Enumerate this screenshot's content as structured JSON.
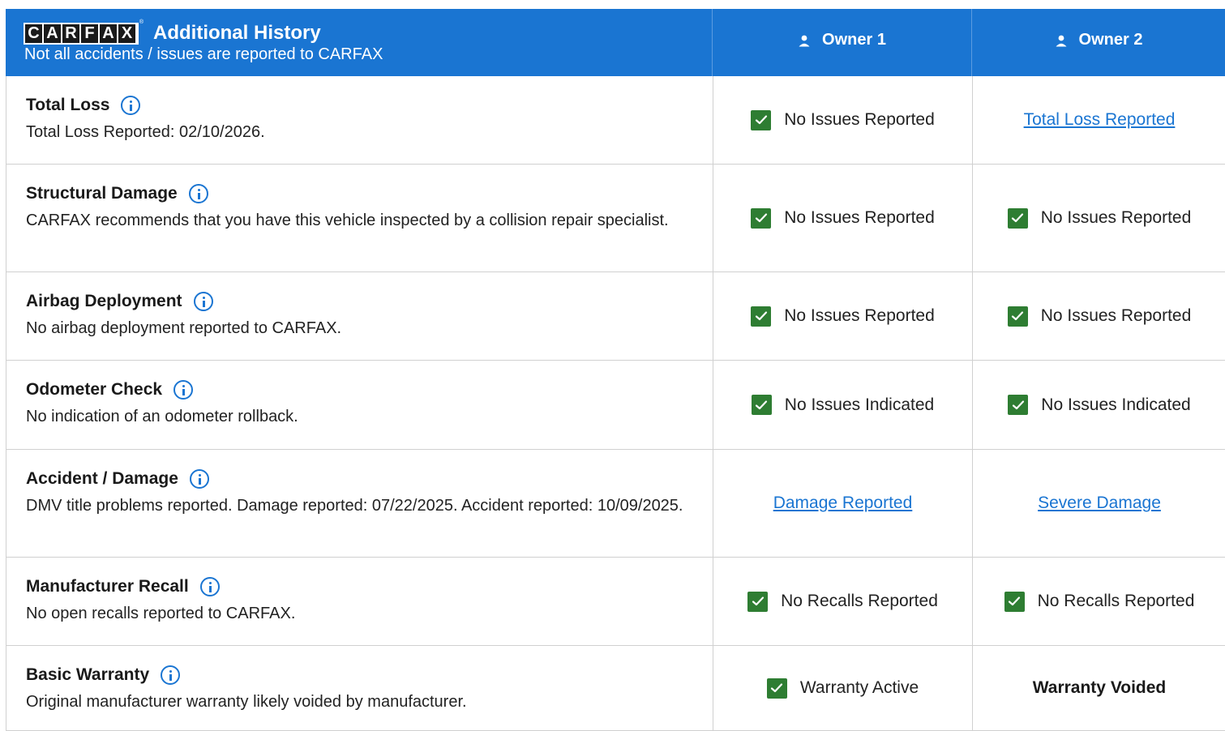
{
  "header": {
    "logo_letters": [
      "C",
      "A",
      "R",
      "F",
      "A",
      "X"
    ],
    "logo_reg": "®",
    "title": "Additional History",
    "subtitle": "Not all accidents / issues are reported to CARFAX",
    "owners": [
      "Owner 1",
      "Owner 2"
    ]
  },
  "colors": {
    "header_bg": "#1a75d2",
    "check_green": "#2e7d32",
    "link_blue": "#1a75d2"
  },
  "rows": [
    {
      "title": "Total Loss",
      "desc": "Total Loss Reported: 02/10/2026.",
      "owner1": {
        "text": "No Issues Reported",
        "kind": "check"
      },
      "owner2": {
        "text": "Total Loss Reported",
        "kind": "link"
      }
    },
    {
      "title": "Structural Damage",
      "desc": "CARFAX recommends that you have this vehicle inspected by a collision repair specialist.",
      "owner1": {
        "text": "No Issues Reported",
        "kind": "check"
      },
      "owner2": {
        "text": "No Issues Reported",
        "kind": "check"
      }
    },
    {
      "title": "Airbag Deployment",
      "desc": "No airbag deployment reported to CARFAX.",
      "owner1": {
        "text": "No Issues Reported",
        "kind": "check"
      },
      "owner2": {
        "text": "No Issues Reported",
        "kind": "check"
      }
    },
    {
      "title": "Odometer Check",
      "desc": "No indication of an odometer rollback.",
      "owner1": {
        "text": "No Issues Indicated",
        "kind": "check"
      },
      "owner2": {
        "text": "No Issues Indicated",
        "kind": "check"
      }
    },
    {
      "title": "Accident / Damage",
      "desc": "DMV title problems reported. Damage reported: 07/22/2025. Accident reported: 10/09/2025.",
      "owner1": {
        "text": "Damage Reported",
        "kind": "link"
      },
      "owner2": {
        "text": "Severe Damage",
        "kind": "link"
      }
    },
    {
      "title": "Manufacturer Recall",
      "desc": "No open recalls reported to CARFAX.",
      "owner1": {
        "text": "No Recalls Reported",
        "kind": "check"
      },
      "owner2": {
        "text": "No Recalls Reported",
        "kind": "check"
      }
    },
    {
      "title": "Basic Warranty",
      "desc": "Original manufacturer warranty likely voided by manufacturer.",
      "owner1": {
        "text": "Warranty Active",
        "kind": "check"
      },
      "owner2": {
        "text": "Warranty Voided",
        "kind": "bold"
      }
    }
  ]
}
